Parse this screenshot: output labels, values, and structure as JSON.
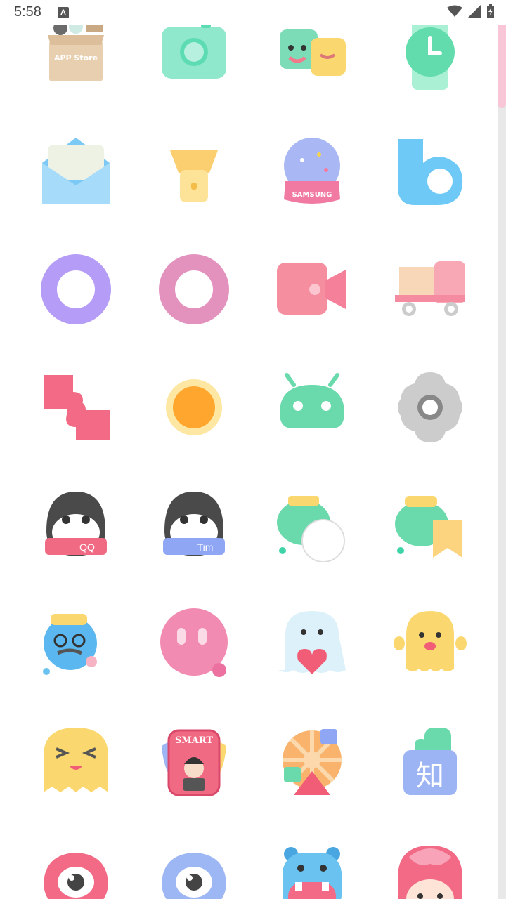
{
  "status_bar": {
    "time": "5:58",
    "notification_badge": "A",
    "icons": [
      "wifi-icon",
      "cellular-signal-icon",
      "battery-charging-icon"
    ]
  },
  "icon_grid": {
    "columns": 4,
    "rows": [
      [
        "app-store-icon",
        "camera-icon",
        "puzzle-friends-icon",
        "clock-watch-icon"
      ],
      [
        "mail-envelope-icon",
        "flashlight-icon",
        "samsung-globe-icon",
        "bixby-icon"
      ],
      [
        "purple-ring-icon",
        "pink-ring-icon",
        "video-camera-icon",
        "delivery-truck-icon"
      ],
      [
        "puzzle-pieces-icon",
        "sun-icon",
        "android-icon",
        "settings-gear-icon"
      ],
      [
        "qq-penguin-icon",
        "tim-penguin-icon",
        "chat-bubbles-icon",
        "bookmark-chat-icon"
      ],
      [
        "blue-character-icon",
        "pink-bubble-icon",
        "ghost-heart-icon",
        "yellow-ghost-icon"
      ],
      [
        "squint-ghost-icon",
        "smart-card-icon",
        "wheel-share-icon",
        "zhihu-icon"
      ],
      [
        "weibo-eye-icon",
        "blue-eye-icon",
        "hippo-icon",
        "flower-girl-icon"
      ]
    ],
    "embedded_text": {
      "app_store": "APP Store",
      "samsung": "SAMSUNG",
      "qq": "QQ",
      "tim": "Tim",
      "smart": "SMART",
      "zhihu": "知"
    }
  },
  "colors": {
    "mint": "#7ee0bd",
    "pink": "#f48ba0",
    "yellow": "#fbd87a",
    "blue": "#7fc7f5",
    "scroll_thumb": "#f8c6d6"
  }
}
